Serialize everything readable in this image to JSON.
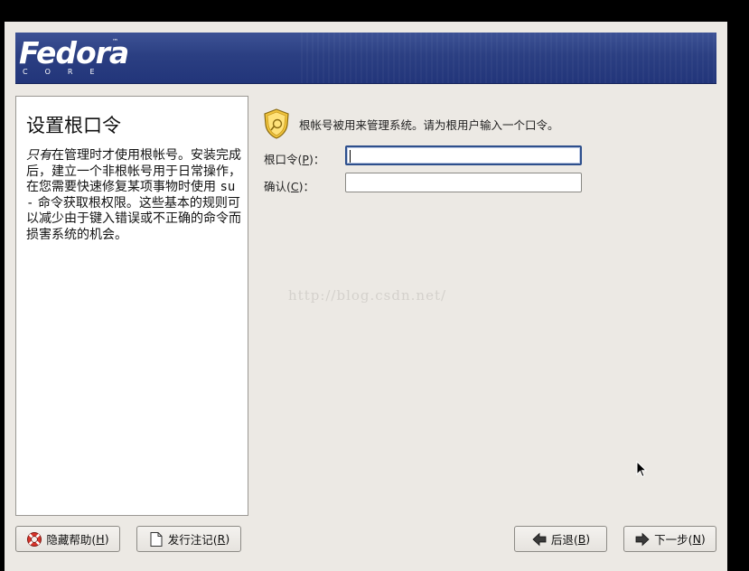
{
  "banner": {
    "logo": "Fedora",
    "tm": "™",
    "sub": "CORE"
  },
  "help": {
    "title": "设置根口令",
    "emph": "只有",
    "text_a": "在管理时才使用根帐号。安装完成后，建立一个非根帐号用于日常操作，在您需要快速修复某项事物时使用 ",
    "command": "su -",
    "text_b": " 命令获取根权限。这些基本的规则可以减少由于键入错误或不正确的命令而损害系统的机会。"
  },
  "form": {
    "intro": "根帐号被用来管理系统。请为根用户输入一个口令。",
    "root_password": {
      "label_pre": "根口令(",
      "mnemonic": "P",
      "label_post": ")：",
      "value": ""
    },
    "confirm": {
      "label_pre": "确认(",
      "mnemonic": "C",
      "label_post": ")：",
      "value": ""
    }
  },
  "watermark": "http://blog.csdn.net/",
  "buttons": {
    "hide_help": {
      "pre": "隐藏帮助(",
      "key": "H",
      "post": ")",
      "icon": "lifebuoy-icon"
    },
    "release_notes": {
      "pre": "发行注记(",
      "key": "R",
      "post": ")",
      "icon": "document-icon"
    },
    "back": {
      "pre": "后退(",
      "key": "B",
      "post": ")",
      "icon": "arrow-left-icon"
    },
    "next": {
      "pre": "下一步(",
      "key": "N",
      "post": ")",
      "icon": "arrow-right-icon"
    }
  },
  "colors": {
    "banner": "#2b3f82",
    "background": "#ece9e4",
    "focus": "#2d4f8c"
  }
}
